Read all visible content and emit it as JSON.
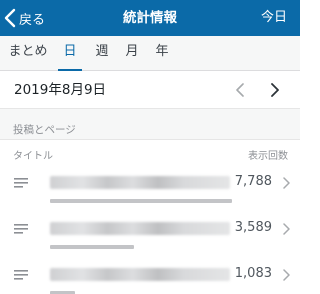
{
  "navbar": {
    "back_label": "戻る",
    "title": "統計情報",
    "right_label": "今日"
  },
  "tabs": [
    {
      "label": "まとめ",
      "active": false
    },
    {
      "label": "日",
      "active": true
    },
    {
      "label": "週",
      "active": false
    },
    {
      "label": "月",
      "active": false
    },
    {
      "label": "年",
      "active": false
    }
  ],
  "date": {
    "label": "2019年8月9日",
    "prev_icon": "chevron-left-icon",
    "next_icon": "chevron-right-icon"
  },
  "section": {
    "header": "投稿とページ",
    "column_title": "タイトル",
    "column_views": "表示回数"
  },
  "rows": [
    {
      "title": "",
      "views": "7,788",
      "bar_fraction": 1.0,
      "icon": "document-icon"
    },
    {
      "title": "",
      "views": "3,589",
      "bar_fraction": 0.46,
      "icon": "document-icon"
    },
    {
      "title": "",
      "views": "1,083",
      "bar_fraction": 0.14,
      "icon": "document-icon"
    }
  ],
  "colors": {
    "brand": "#0b6aa8",
    "tab_background": "#f6f7f7",
    "bar": "#c3c4c7"
  }
}
